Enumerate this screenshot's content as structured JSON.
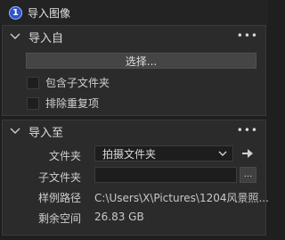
{
  "window": {
    "title": "导入图像",
    "app_icon_glyph": "1"
  },
  "import_from": {
    "title": "导入自",
    "select_button": "选择...",
    "include_subfolders": "包含子文件夹",
    "exclude_duplicates": "排除重复项"
  },
  "import_to": {
    "title": "导入至",
    "folder_label": "文件夹",
    "folder_value": "拍摄文件夹",
    "subfolder_label": "子文件夹",
    "subfolder_value": "",
    "browse_label": "...",
    "sample_path_label": "样例路径",
    "sample_path_value": "C:\\Users\\X\\Pictures\\1204风景照...",
    "free_space_label": "剩余空间",
    "free_space_value": "26.83 GB"
  },
  "icons": {
    "panel_collapse": "chevron-down-icon",
    "more": "more-icon",
    "dropdown": "caret-down-icon",
    "go": "arrow-right-icon"
  }
}
